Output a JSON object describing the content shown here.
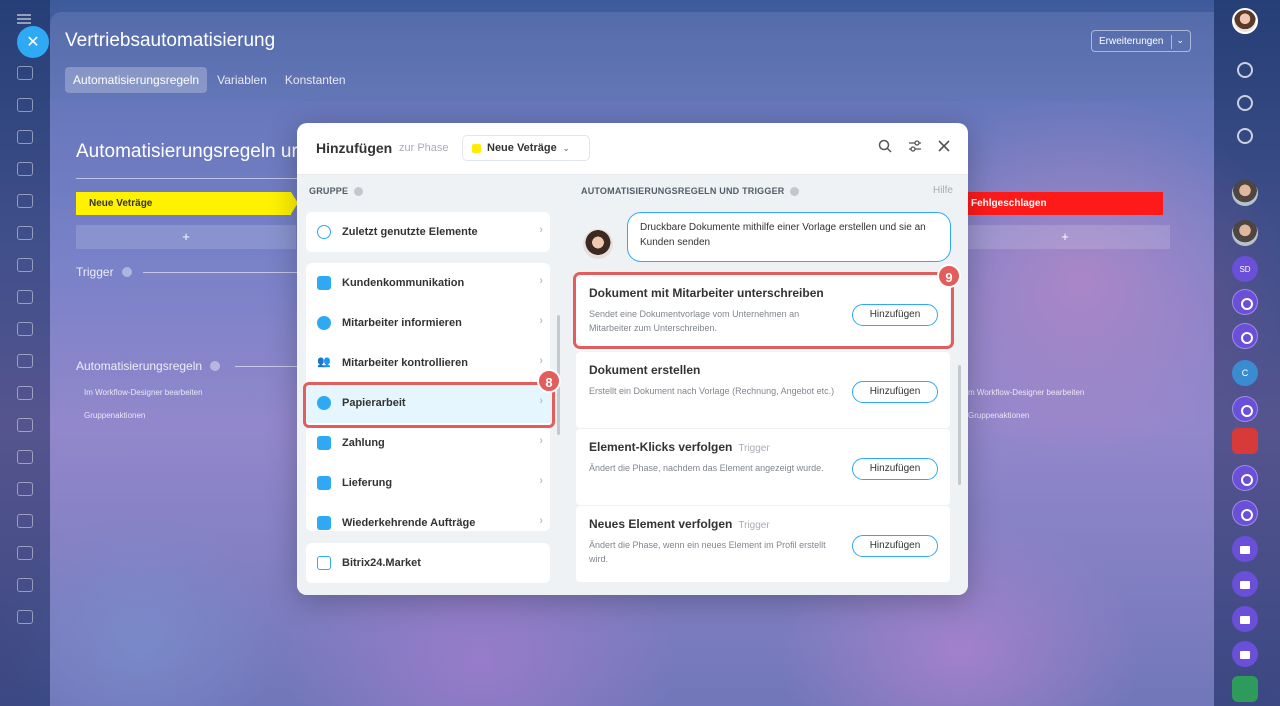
{
  "app": {
    "slider_title": "Vertriebsautomatisierung",
    "extensions_label": "Erweiterungen",
    "tabs": [
      "Automatisierungsregeln",
      "Variablen",
      "Konstanten"
    ]
  },
  "canvas": {
    "title": "Automatisierungsregeln ur",
    "stage_first": "Neue Veträge",
    "stage_last": "Fehlgeschlagen",
    "plus": "+",
    "trigger_label": "Trigger",
    "rules_label": "Automatisierungsregeln",
    "edit_link": "Im Workflow-Designer bearbeiten",
    "edit_link_right": "m Workflow-Designer bearbeiten",
    "group_actions": "Gruppenaktionen",
    "group_actions_right": "Gruppenaktionen"
  },
  "modal": {
    "title": "Hinzufügen",
    "phase_prefix": "zur Phase",
    "phase_value": "Neue Veträge",
    "left_header": "GRUPPE",
    "right_header": "AUTOMATISIERUNGSREGELN UND TRIGGER",
    "help": "Hilfe",
    "recent": "Zuletzt genutzte Elemente",
    "groups": [
      "Kundenkommunikation",
      "Mitarbeiter informieren",
      "Mitarbeiter kontrollieren",
      "Papierarbeit",
      "Zahlung",
      "Lieferung",
      "Wiederkehrende Aufträge"
    ],
    "market": "Bitrix24.Market",
    "bot_text": "Druckbare Dokumente mithilfe einer Vorlage erstellen und sie an Kunden senden",
    "rules": [
      {
        "title": "Dokument mit Mitarbeiter unterschreiben",
        "tag": "",
        "desc": "Sendet eine Dokumentvorlage vom Unternehmen an Mitarbeiter zum Unterschreiben.",
        "button": "Hinzufügen"
      },
      {
        "title": "Dokument erstellen",
        "tag": "",
        "desc": "Erstellt ein Dokument nach Vorlage (Rechnung, Angebot etc.)",
        "button": "Hinzufügen"
      },
      {
        "title": "Element-Klicks verfolgen",
        "tag": "Trigger",
        "desc": "Ändert die Phase, nachdem das Element angezeigt wurde.",
        "button": "Hinzufügen"
      },
      {
        "title": "Neues Element verfolgen",
        "tag": "Trigger",
        "desc": "Ändert die Phase, wenn ein neues Element im Profil erstellt wird.",
        "button": "Hinzufügen"
      }
    ],
    "badges": [
      "8",
      "9"
    ]
  },
  "colors": {
    "accent": "#2fa9f3",
    "highlight": "#e35d5d",
    "stage_yellow": "#fff200",
    "stage_red": "#ff1a1a"
  },
  "icons": {
    "close": "close-icon",
    "search": "search-icon",
    "filter": "filter-icon",
    "chevron": "chevron-right-icon"
  }
}
